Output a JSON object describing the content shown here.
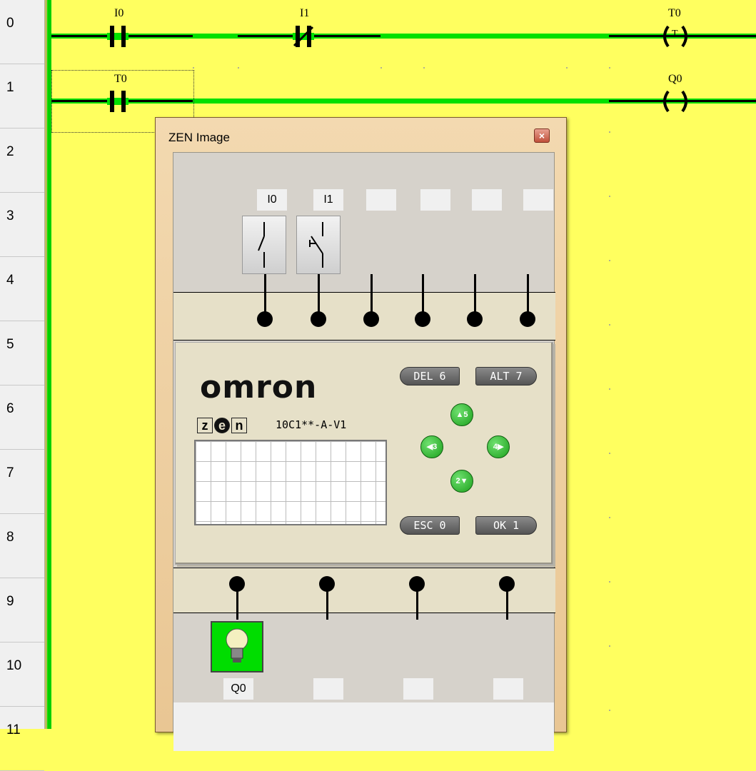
{
  "ladder": {
    "rows": [
      "0",
      "1",
      "2",
      "3",
      "4",
      "5",
      "6",
      "7",
      "8",
      "9",
      "10",
      "11"
    ],
    "rung0": {
      "contact1_label": "I0",
      "contact2_label": "I1",
      "coil_label": "T0",
      "coil_symbol": "T"
    },
    "rung1": {
      "contact1_label": "T0",
      "coil_label": "Q0"
    },
    "colors": {
      "background": "#ffff5f",
      "rail": "#00d000"
    }
  },
  "zen_window": {
    "title": "ZEN Image",
    "close_glyph": "×",
    "inputs": [
      "I0",
      "I1",
      "",
      "",
      "",
      ""
    ],
    "brand": "omron",
    "logo_letters": [
      "z",
      "e",
      "n"
    ],
    "model": "10C1**-A-V1",
    "buttons": {
      "del": "DEL 6",
      "alt": "ALT 7",
      "esc": "ESC 0",
      "ok": "OK  1",
      "up": "5",
      "left": "3",
      "right": "4",
      "down": "2"
    },
    "outputs": [
      "Q0",
      "",
      "",
      ""
    ]
  }
}
